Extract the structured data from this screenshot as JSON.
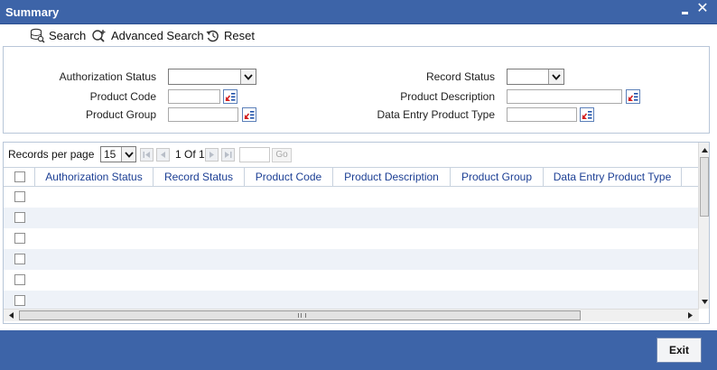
{
  "window": {
    "title": "Summary"
  },
  "toolbar": {
    "search_label": "Search",
    "advanced_search_label": "Advanced Search",
    "reset_label": "Reset"
  },
  "criteria": {
    "authorization_status_label": "Authorization Status",
    "authorization_status_value": "",
    "product_code_label": "Product Code",
    "product_code_value": "",
    "product_group_label": "Product Group",
    "product_group_value": "",
    "record_status_label": "Record Status",
    "record_status_value": "",
    "product_description_label": "Product Description",
    "product_description_value": "",
    "data_entry_product_type_label": "Data Entry Product Type",
    "data_entry_product_type_value": ""
  },
  "pager": {
    "records_per_page_label": "Records per page",
    "records_per_page_value": "15",
    "page_info": "1 Of 1",
    "goto_value": "",
    "go_label": "Go"
  },
  "grid": {
    "columns": [
      "Authorization Status",
      "Record Status",
      "Product Code",
      "Product Description",
      "Product Group",
      "Data Entry Product Type"
    ],
    "rows": []
  },
  "footer": {
    "exit_label": "Exit"
  },
  "colors": {
    "titlebar": "#3d64a8",
    "header_text": "#1c3f94",
    "alt_row": "#eef2f8"
  }
}
